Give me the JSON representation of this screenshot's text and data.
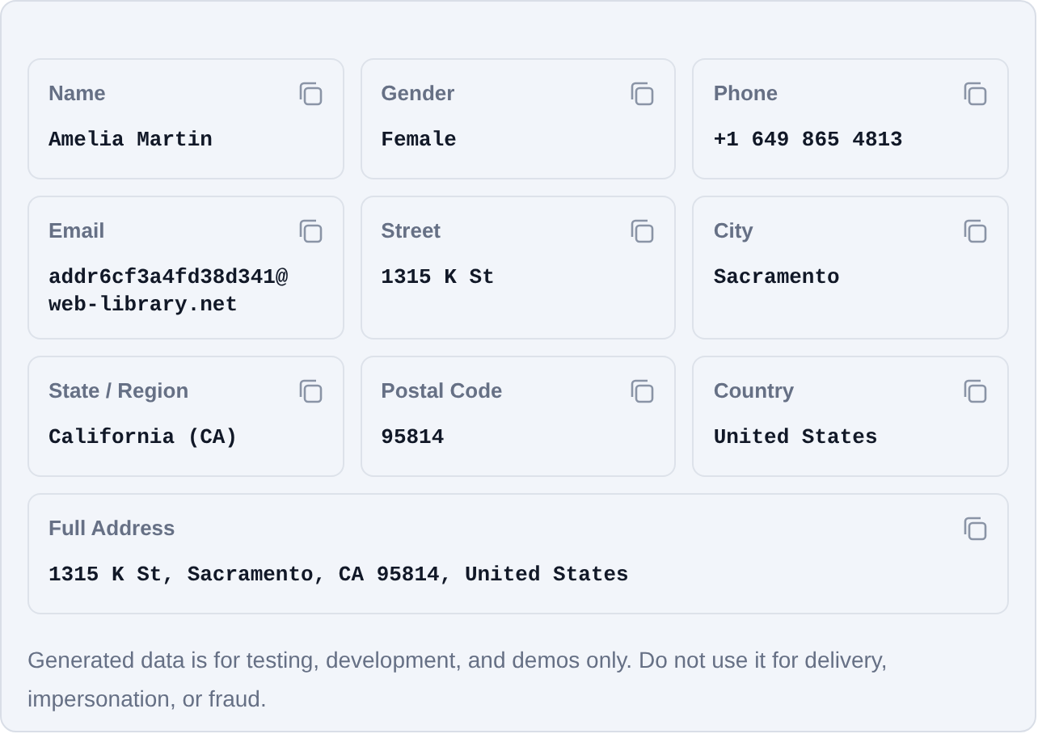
{
  "fields": [
    {
      "label": "Name",
      "value": "Amelia Martin",
      "wide": false
    },
    {
      "label": "Gender",
      "value": "Female",
      "wide": false
    },
    {
      "label": "Phone",
      "value": "+1 649 865 4813",
      "wide": false
    },
    {
      "label": "Email",
      "value": "addr6cf3a4fd38d341@web-library.net",
      "wide": false
    },
    {
      "label": "Street",
      "value": "1315 K St",
      "wide": false
    },
    {
      "label": "City",
      "value": "Sacramento",
      "wide": false
    },
    {
      "label": "State / Region",
      "value": "California (CA)",
      "wide": false
    },
    {
      "label": "Postal Code",
      "value": "95814",
      "wide": false
    },
    {
      "label": "Country",
      "value": "United States",
      "wide": false
    },
    {
      "label": "Full Address",
      "value": "1315 K St, Sacramento, CA 95814, United States",
      "wide": true
    }
  ],
  "disclaimer": "Generated data is for testing, development, and demos only. Do not use it for delivery, impersonation, or fraud."
}
